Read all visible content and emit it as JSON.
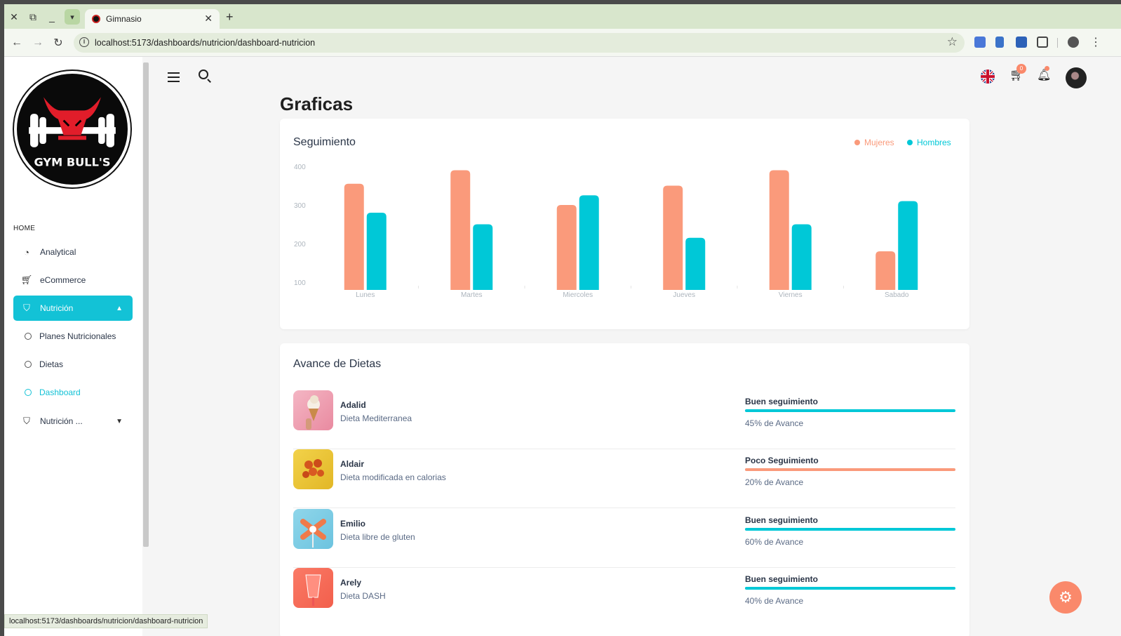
{
  "browser": {
    "tab_title": "Gimnasio",
    "url": "localhost:5173/dashboards/nutricion/dashboard-nutricion",
    "status_url": "localhost:5173/dashboards/nutricion/dashboard-nutricion"
  },
  "logo": {
    "text": "GYM BULL'S"
  },
  "sidebar": {
    "section": "HOME",
    "items": [
      {
        "label": "Analytical",
        "icon": "pie-chart-icon"
      },
      {
        "label": "eCommerce",
        "icon": "cart-icon"
      },
      {
        "label": "Nutrición",
        "icon": "basket-icon"
      },
      {
        "label": "Nutrición ...",
        "icon": "basket-icon"
      }
    ],
    "subitems": [
      {
        "label": "Planes Nutricionales"
      },
      {
        "label": "Dietas"
      },
      {
        "label": "Dashboard"
      }
    ]
  },
  "header": {
    "cart_count": "0"
  },
  "page": {
    "title": "Graficas"
  },
  "chart_card": {
    "title": "Seguimiento"
  },
  "chart_data": {
    "type": "bar",
    "categories": [
      "Lunes",
      "Martes",
      "Miercoles",
      "Jueves",
      "Viernes",
      "Sabado"
    ],
    "series": [
      {
        "name": "Mujeres",
        "color": "#fa9a7b",
        "values": [
          355,
          390,
          300,
          350,
          390,
          180
        ]
      },
      {
        "name": "Hombres",
        "color": "#00c8d7",
        "values": [
          280,
          250,
          325,
          215,
          250,
          310
        ]
      }
    ],
    "y_ticks": [
      100,
      200,
      300,
      400
    ],
    "ylim": [
      80,
      400
    ],
    "legend": "top-right"
  },
  "diets_card": {
    "title": "Avance de Dietas",
    "rows": [
      {
        "name": "Adalid",
        "diet": "Dieta Mediterranea",
        "status": "Buen seguimiento",
        "progress_text": "45% de Avance",
        "color": "#00c8d7"
      },
      {
        "name": "Aldair",
        "diet": "Dieta modificada en calorias",
        "status": "Poco Seguimiento",
        "progress_text": "20% de Avance",
        "color": "#fa9a7b"
      },
      {
        "name": "Emilio",
        "diet": "Dieta libre de gluten",
        "status": "Buen seguimiento",
        "progress_text": "60% de Avance",
        "color": "#00c8d7"
      },
      {
        "name": "Arely",
        "diet": "Dieta DASH",
        "status": "Buen seguimiento",
        "progress_text": "40% de Avance",
        "color": "#00c8d7"
      }
    ]
  }
}
